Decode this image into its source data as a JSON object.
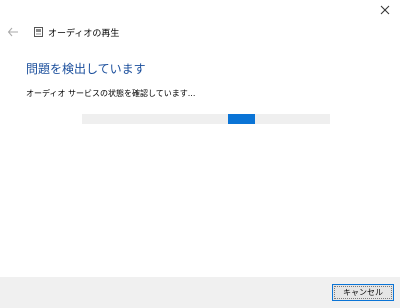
{
  "window": {
    "title": "オーディオの再生"
  },
  "header": {
    "back_icon": "back-arrow-icon",
    "app_icon": "audio-troubleshooter-icon",
    "close_icon": "close-icon"
  },
  "main": {
    "heading": "問題を検出しています",
    "status": "オーディオ サービスの状態を確認しています..."
  },
  "progress": {
    "indeterminate": true,
    "chunk_start_fraction": 0.59,
    "chunk_width_fraction": 0.11,
    "track_color": "#efefef",
    "fill_color": "#0a74d6"
  },
  "footer": {
    "cancel_label": "キャンセル"
  },
  "colors": {
    "heading": "#1a4e9c",
    "accent": "#0a74d6",
    "footer_bg": "#f0f0f0"
  }
}
